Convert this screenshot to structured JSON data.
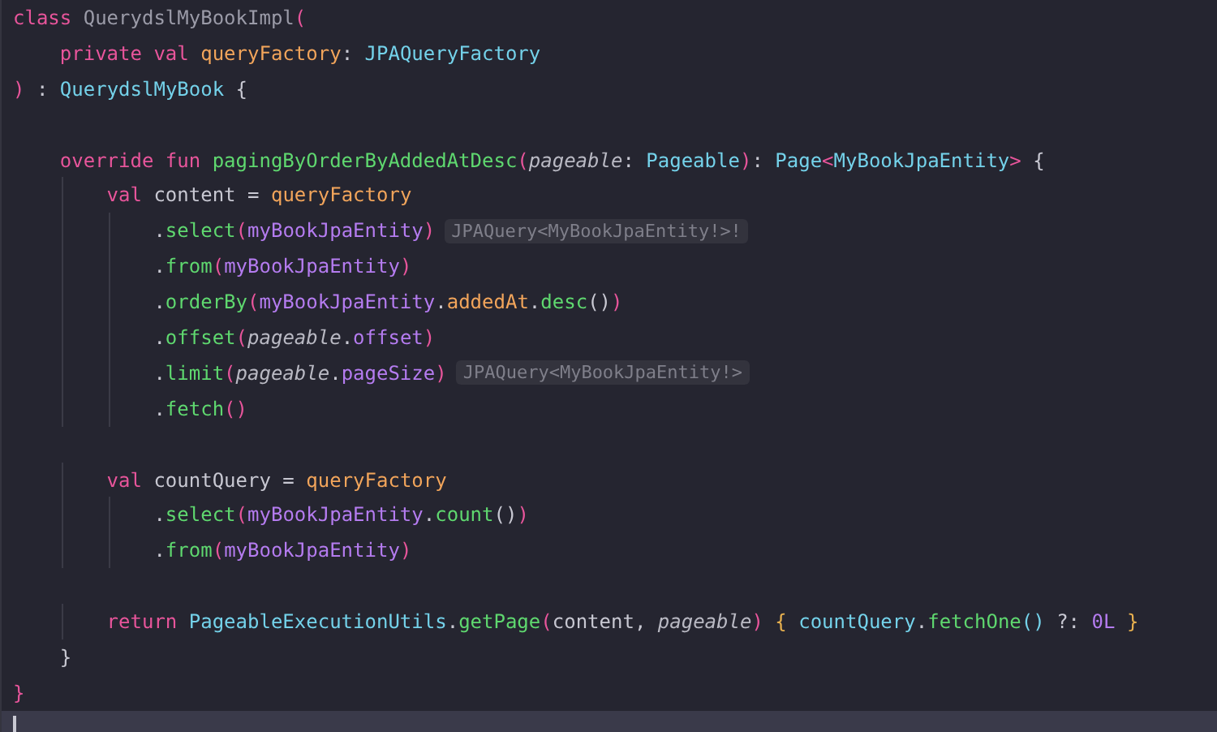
{
  "editor": {
    "lines": [
      {
        "current": false,
        "tokens": [
          {
            "text": "class ",
            "kind": "keyword"
          },
          {
            "text": "QuerydslMyBookImpl",
            "kind": "dim"
          },
          {
            "text": "(",
            "kind": "bracket"
          }
        ]
      },
      {
        "current": false,
        "tokens": [
          {
            "text": "    private ",
            "kind": "keyword"
          },
          {
            "text": "val ",
            "kind": "keyword"
          },
          {
            "text": "queryFactory",
            "kind": "property"
          },
          {
            "text": ": ",
            "kind": "plain"
          },
          {
            "text": "JPAQueryFactory",
            "kind": "type"
          }
        ]
      },
      {
        "current": false,
        "tokens": [
          {
            "text": ")",
            "kind": "bracket"
          },
          {
            "text": " : ",
            "kind": "plain"
          },
          {
            "text": "QuerydslMyBook",
            "kind": "type"
          },
          {
            "text": " {",
            "kind": "plain"
          }
        ]
      },
      {
        "current": false
      },
      {
        "current": false,
        "tokens": [
          {
            "text": "    override ",
            "kind": "keyword"
          },
          {
            "text": "fun ",
            "kind": "keyword"
          },
          {
            "text": "pagingByOrderByAddedAtDesc",
            "kind": "function"
          },
          {
            "text": "(",
            "kind": "bracket"
          },
          {
            "text": "pageable",
            "kind": "param"
          },
          {
            "text": ": ",
            "kind": "plain"
          },
          {
            "text": "Pageable",
            "kind": "type"
          },
          {
            "text": ")",
            "kind": "bracket"
          },
          {
            "text": ": ",
            "kind": "plain"
          },
          {
            "text": "Page",
            "kind": "type"
          },
          {
            "text": "<",
            "kind": "bracket"
          },
          {
            "text": "MyBookJpaEntity",
            "kind": "type"
          },
          {
            "text": ">",
            "kind": "bracket"
          },
          {
            "text": " {",
            "kind": "plain"
          }
        ]
      },
      {
        "current": false,
        "tokens": [
          {
            "text": "        val",
            "kind": "keyword"
          },
          {
            "text": " content = ",
            "kind": "plain"
          },
          {
            "text": "queryFactory",
            "kind": "property"
          }
        ]
      },
      {
        "current": false,
        "hint": "JPAQuery<MyBookJpaEntity!>!",
        "tokens": [
          {
            "text": "            .",
            "kind": "plain"
          },
          {
            "text": "select",
            "kind": "function"
          },
          {
            "text": "(",
            "kind": "bracket"
          },
          {
            "text": "myBookJpaEntity",
            "kind": "field"
          },
          {
            "text": ")",
            "kind": "bracket"
          }
        ]
      },
      {
        "current": false,
        "tokens": [
          {
            "text": "            .",
            "kind": "plain"
          },
          {
            "text": "from",
            "kind": "function"
          },
          {
            "text": "(",
            "kind": "bracket"
          },
          {
            "text": "myBookJpaEntity",
            "kind": "field"
          },
          {
            "text": ")",
            "kind": "bracket"
          }
        ]
      },
      {
        "current": false,
        "tokens": [
          {
            "text": "            .",
            "kind": "plain"
          },
          {
            "text": "orderBy",
            "kind": "function"
          },
          {
            "text": "(",
            "kind": "bracket"
          },
          {
            "text": "myBookJpaEntity",
            "kind": "field"
          },
          {
            "text": ".",
            "kind": "plain"
          },
          {
            "text": "addedAt",
            "kind": "property"
          },
          {
            "text": ".",
            "kind": "plain"
          },
          {
            "text": "desc",
            "kind": "function"
          },
          {
            "text": "()",
            "kind": "plain"
          },
          {
            "text": ")",
            "kind": "bracket"
          }
        ]
      },
      {
        "current": false,
        "tokens": [
          {
            "text": "            .",
            "kind": "plain"
          },
          {
            "text": "offset",
            "kind": "function"
          },
          {
            "text": "(",
            "kind": "bracket"
          },
          {
            "text": "pageable",
            "kind": "param"
          },
          {
            "text": ".",
            "kind": "plain"
          },
          {
            "text": "offset",
            "kind": "field"
          },
          {
            "text": ")",
            "kind": "bracket"
          }
        ]
      },
      {
        "current": false,
        "hint": "JPAQuery<MyBookJpaEntity!>",
        "tokens": [
          {
            "text": "            .",
            "kind": "plain"
          },
          {
            "text": "limit",
            "kind": "function"
          },
          {
            "text": "(",
            "kind": "bracket"
          },
          {
            "text": "pageable",
            "kind": "param"
          },
          {
            "text": ".",
            "kind": "plain"
          },
          {
            "text": "pageSize",
            "kind": "field"
          },
          {
            "text": ")",
            "kind": "bracket"
          }
        ]
      },
      {
        "current": false,
        "tokens": [
          {
            "text": "            .",
            "kind": "plain"
          },
          {
            "text": "fetch",
            "kind": "function"
          },
          {
            "text": "()",
            "kind": "bracket"
          }
        ]
      },
      {
        "current": false
      },
      {
        "current": false,
        "tokens": [
          {
            "text": "        val",
            "kind": "keyword"
          },
          {
            "text": " countQuery = ",
            "kind": "plain"
          },
          {
            "text": "queryFactory",
            "kind": "property"
          }
        ]
      },
      {
        "current": false,
        "tokens": [
          {
            "text": "            .",
            "kind": "plain"
          },
          {
            "text": "select",
            "kind": "function"
          },
          {
            "text": "(",
            "kind": "bracket"
          },
          {
            "text": "myBookJpaEntity",
            "kind": "field"
          },
          {
            "text": ".",
            "kind": "plain"
          },
          {
            "text": "count",
            "kind": "function"
          },
          {
            "text": "()",
            "kind": "plain"
          },
          {
            "text": ")",
            "kind": "bracket"
          }
        ]
      },
      {
        "current": false,
        "tokens": [
          {
            "text": "            .",
            "kind": "plain"
          },
          {
            "text": "from",
            "kind": "function"
          },
          {
            "text": "(",
            "kind": "bracket"
          },
          {
            "text": "myBookJpaEntity",
            "kind": "field"
          },
          {
            "text": ")",
            "kind": "bracket"
          }
        ]
      },
      {
        "current": false
      },
      {
        "current": false,
        "tokens": [
          {
            "text": "        return ",
            "kind": "keyword"
          },
          {
            "text": "PageableExecutionUtils",
            "kind": "type"
          },
          {
            "text": ".",
            "kind": "plain"
          },
          {
            "text": "getPage",
            "kind": "function"
          },
          {
            "text": "(",
            "kind": "bracket"
          },
          {
            "text": "content, ",
            "kind": "plain"
          },
          {
            "text": "pageable",
            "kind": "param"
          },
          {
            "text": ") ",
            "kind": "bracket"
          },
          {
            "text": "{ ",
            "kind": "brace"
          },
          {
            "text": "countQuery",
            "kind": "type"
          },
          {
            "text": ".",
            "kind": "plain"
          },
          {
            "text": "fetchOne",
            "kind": "function"
          },
          {
            "text": "()",
            "kind": "type"
          },
          {
            "text": " ?: ",
            "kind": "plain"
          },
          {
            "text": "0L ",
            "kind": "field"
          },
          {
            "text": "}",
            "kind": "brace"
          }
        ]
      },
      {
        "current": false,
        "tokens": [
          {
            "text": "    }",
            "kind": "plain"
          }
        ]
      },
      {
        "current": false,
        "tokens": [
          {
            "text": "}",
            "kind": "bracket"
          }
        ]
      },
      {
        "current": true
      }
    ]
  }
}
